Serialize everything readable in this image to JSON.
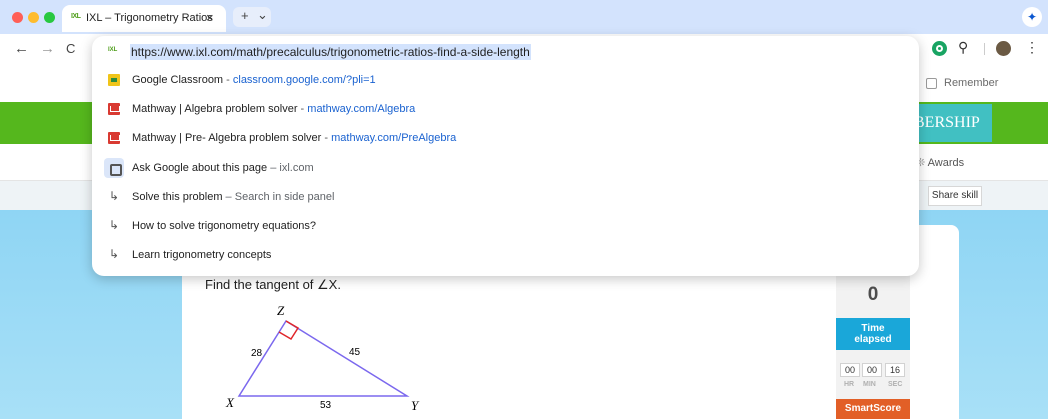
{
  "browser": {
    "tab": {
      "favicon": "IXL",
      "title": "IXL – Trigonometry Ratios",
      "close": "×"
    },
    "new_tab": {
      "plus": "+",
      "chevron": "⌄"
    },
    "nav": {
      "back": "←",
      "forward": "→",
      "reload": "C"
    },
    "toolbar_icons": [
      "grammarly-icon",
      "extensions-icon",
      "avatar",
      "kebab-menu-icon"
    ],
    "toolbar_symbols": {
      "extensions": "⚲",
      "menu": "⋮",
      "spark": "✦"
    }
  },
  "omnibox": {
    "favicon": "IXL",
    "url": "https://www.ixl.com/math/precalculus/trigonometric-ratios-find-a-side-length",
    "suggestions": [
      {
        "icon": "google-classroom-icon",
        "title": "Google Classroom",
        "sep": " - ",
        "detail": "classroom.google.com/?pli=1",
        "style": "url"
      },
      {
        "icon": "mathway-icon",
        "title": "Mathway | Algebra problem solver",
        "sep": " - ",
        "detail": "mathway.com/Algebra",
        "style": "url"
      },
      {
        "icon": "mathway-icon",
        "title": "Mathway | Pre- Algebra problem solver",
        "sep": " - ",
        "detail": "mathway.com/PreAlgebra",
        "style": "url"
      },
      {
        "icon": "google-lens-icon",
        "title": "Ask Google about this page",
        "sep": " – ",
        "detail": "ixl.com",
        "style": "dim"
      },
      {
        "icon": "arrow-icon",
        "title": "Solve this problem",
        "sep": " – ",
        "detail": "Search in side panel",
        "style": "dim"
      },
      {
        "icon": "arrow-icon",
        "title": "How to solve trigonometry equations?",
        "sep": "",
        "detail": "",
        "style": "dim"
      },
      {
        "icon": "arrow-icon",
        "title": "Learn trigonometry concepts",
        "sep": "",
        "detail": "",
        "style": "dim"
      }
    ],
    "arrow_glyph": "↳"
  },
  "page": {
    "remember_label": "Remember",
    "membership_button": "BERSHIP",
    "awards_label": "Awards",
    "awards_icon": "❊",
    "share_button": "Share skill",
    "question": "Find the tangent of ∠X.",
    "triangle": {
      "vertices": {
        "x": "X",
        "y": "Y",
        "z": "Z"
      },
      "sides": {
        "xz": "28",
        "zy": "45",
        "xy": "53"
      }
    },
    "questions_answered": "0",
    "time_elapsed_label": [
      "Time",
      "elapsed"
    ],
    "timer": {
      "values": [
        "00",
        "00",
        "16"
      ],
      "labels": [
        "HR",
        "MIN",
        "SEC"
      ]
    },
    "smartscore_label": "SmartScore"
  },
  "colors": {
    "tab_strip": "#d3e3fd",
    "ixl_green": "#55b71d",
    "membership_teal": "#41c0c2",
    "sky": "#8fd5f4",
    "time_blue": "#1aa7d9",
    "smartscore_orange": "#e25f27",
    "triangle_stroke": "#7b68ee",
    "right_angle": "#e0262a",
    "link_blue": "#1a62d0"
  }
}
